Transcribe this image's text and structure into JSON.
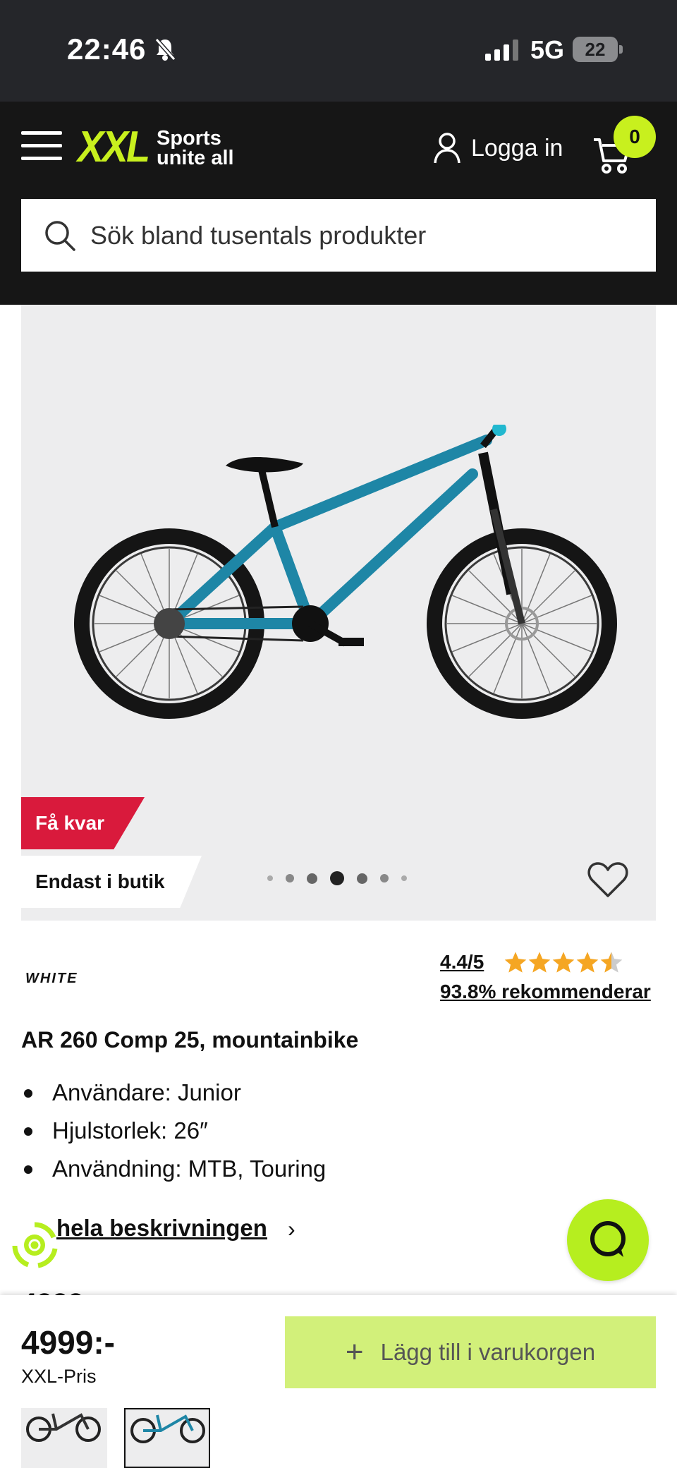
{
  "status_bar": {
    "time": "22:46",
    "network": "5G",
    "battery": "22"
  },
  "header": {
    "logo_text": "XXL",
    "logo_tagline_1": "Sports",
    "logo_tagline_2": "unite all",
    "login_label": "Logga in",
    "cart_count": "0"
  },
  "search": {
    "placeholder": "Sök bland tusentals produkter"
  },
  "gallery": {
    "badge_few_left": "Få kvar",
    "badge_store_only": "Endast i butik",
    "dots_total": 7,
    "dots_active_index": 3
  },
  "product": {
    "brand": "WHITE",
    "rating": "4.4/5",
    "rating_value": 4.4,
    "recommend": "93.8% rekommenderar",
    "title": "AR 260 Comp 25, mountainbike",
    "features": [
      "Användare: Junior",
      "Hjulstorlek: 26″",
      "Användning: MTB, Touring"
    ],
    "full_description_link": "hela beskrivningen",
    "peek_price": "4999"
  },
  "purchase": {
    "price": "4999:-",
    "price_label": "XXL-Pris",
    "add_to_cart": "Lägg till i varukorgen"
  },
  "colors": {
    "accent": "#c8f01e",
    "header_bg": "#161616",
    "badge_red": "#d91a3c",
    "button_bg": "#d2f07a",
    "star": "#f5a623"
  }
}
